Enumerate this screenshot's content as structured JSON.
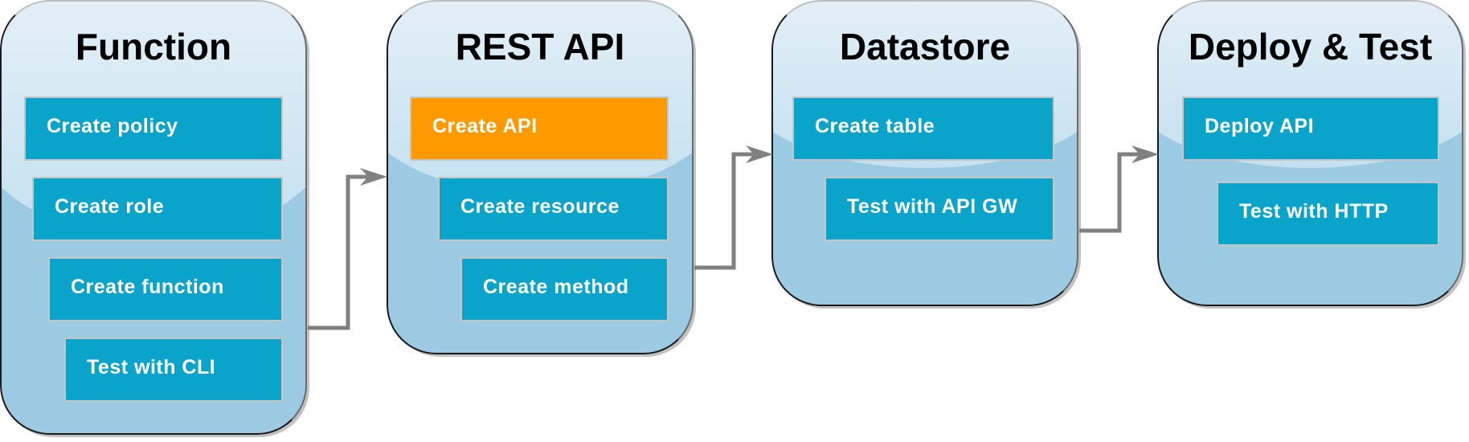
{
  "diagram": {
    "stages": [
      {
        "title": "Function",
        "steps": [
          {
            "label": "Create policy",
            "active": false
          },
          {
            "label": "Create role",
            "active": false
          },
          {
            "label": "Create function",
            "active": false
          },
          {
            "label": "Test with CLI",
            "active": false
          }
        ]
      },
      {
        "title": "REST API",
        "steps": [
          {
            "label": "Create API",
            "active": true
          },
          {
            "label": "Create resource",
            "active": false
          },
          {
            "label": "Create method",
            "active": false
          }
        ]
      },
      {
        "title": "Datastore",
        "steps": [
          {
            "label": "Create table",
            "active": false
          },
          {
            "label": "Test with API GW",
            "active": false
          }
        ]
      },
      {
        "title": "Deploy & Test",
        "steps": [
          {
            "label": "Deploy API",
            "active": false
          },
          {
            "label": "Test with HTTP",
            "active": false
          }
        ]
      }
    ],
    "connectors": [
      {
        "from": "Function",
        "to": "REST API"
      },
      {
        "from": "REST API",
        "to": "Datastore"
      },
      {
        "from": "Datastore",
        "to": "Deploy & Test"
      }
    ],
    "colors": {
      "step_fill": "#0aa3c9",
      "active_step_fill": "#ff9900",
      "stage_fill": "#9dcae3",
      "connector": "#808080"
    }
  }
}
